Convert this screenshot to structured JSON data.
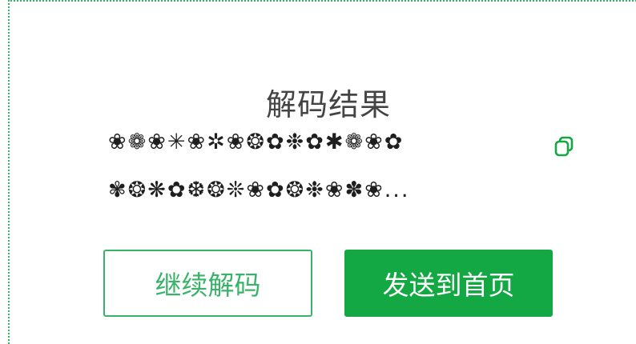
{
  "result": {
    "title": "解码结果",
    "line1": "❀❁❀✳❀✲❀❂✿❉✿✱❁❀✿",
    "line2": "✾❂❋✿❆❂❊❀✿❂❉❀✽❀...",
    "copy_icon": "copy-icon"
  },
  "actions": {
    "continue_label": "继续解码",
    "send_label": "发送到首页"
  },
  "colors": {
    "accent": "#39b36a",
    "primary_button": "#13a843",
    "border_dotted": "#39b36a"
  }
}
